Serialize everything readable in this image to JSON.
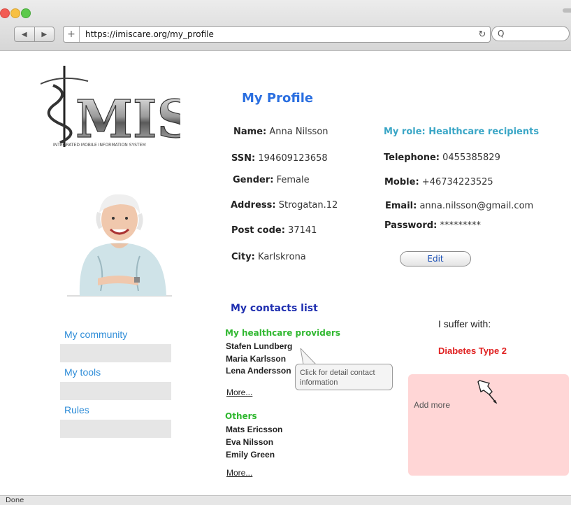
{
  "browser": {
    "url": "https://imiscare.org/my_profile",
    "back_icon": "back-arrow-icon",
    "forward_icon": "forward-arrow-icon",
    "add_tab_glyph": "+",
    "reload_glyph": "↻",
    "search_glyph": "Q",
    "status": "Done"
  },
  "profile": {
    "title": "My Profile",
    "fields_left": [
      {
        "label": "Name:",
        "value": "Anna Nilsson"
      },
      {
        "label": "SSN:",
        "value": "194609123658"
      },
      {
        "label": "Gender:",
        "value": "Female"
      },
      {
        "label": "Address:",
        "value": "Strogatan.12"
      },
      {
        "label": "Post code:",
        "value": "37141"
      },
      {
        "label": "City:",
        "value": "Karlskrona"
      }
    ],
    "role": "My role: Healthcare recipients",
    "fields_right": [
      {
        "label": "Telephone:",
        "value": "0455385829"
      },
      {
        "label": "Moble:",
        "value": "+46734223525"
      },
      {
        "label": "Email:",
        "value": "anna.nilsson@gmail.com"
      },
      {
        "label": "Password:",
        "value": "*********"
      }
    ],
    "edit_label": "Edit"
  },
  "sidebar": {
    "items": [
      {
        "label": "My community"
      },
      {
        "label": "My tools"
      },
      {
        "label": "Rules"
      }
    ]
  },
  "contacts": {
    "title": "My contacts list",
    "providers_title": "My healthcare providers",
    "providers": [
      "Stafen Lundberg",
      "Maria Karlsson",
      "Lena Andersson"
    ],
    "providers_more": "More...",
    "tooltip": "Click for detail contact information",
    "others_title": "Others",
    "others": [
      "Mats Ericsson",
      "Eva Nilsson",
      "Emily Green"
    ],
    "others_more": "More..."
  },
  "suffer": {
    "title": "I suffer with:",
    "condition": "Diabetes Type 2",
    "add_more": "Add more"
  },
  "colors": {
    "title_blue": "#2b6fe0",
    "role_teal": "#3aa6c6",
    "link_blue": "#2f8dd8",
    "contacts_blue": "#1f2fb0",
    "group_green": "#30b830",
    "condition_red": "#e02020",
    "panel_pink": "#ffd6d6"
  }
}
